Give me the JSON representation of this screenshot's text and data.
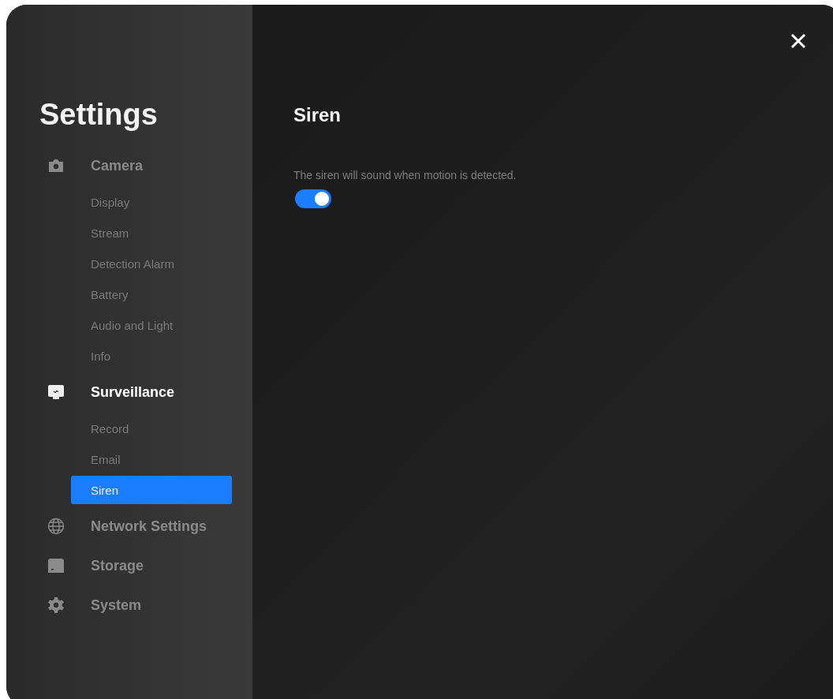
{
  "sidebar": {
    "title": "Settings",
    "groups": [
      {
        "label": "Camera",
        "selected": false,
        "children": [
          {
            "label": "Display",
            "selected": false
          },
          {
            "label": "Stream",
            "selected": false
          },
          {
            "label": "Detection Alarm",
            "selected": false
          },
          {
            "label": "Battery",
            "selected": false
          },
          {
            "label": "Audio and Light",
            "selected": false
          },
          {
            "label": "Info",
            "selected": false
          }
        ]
      },
      {
        "label": "Surveillance",
        "selected": true,
        "children": [
          {
            "label": "Record",
            "selected": false
          },
          {
            "label": "Email",
            "selected": false
          },
          {
            "label": "Siren",
            "selected": true
          }
        ]
      },
      {
        "label": "Network Settings",
        "selected": false
      },
      {
        "label": "Storage",
        "selected": false
      },
      {
        "label": "System",
        "selected": false
      }
    ]
  },
  "content": {
    "title": "Siren",
    "description": "The siren will sound when motion is detected.",
    "toggle": {
      "on": true
    }
  }
}
